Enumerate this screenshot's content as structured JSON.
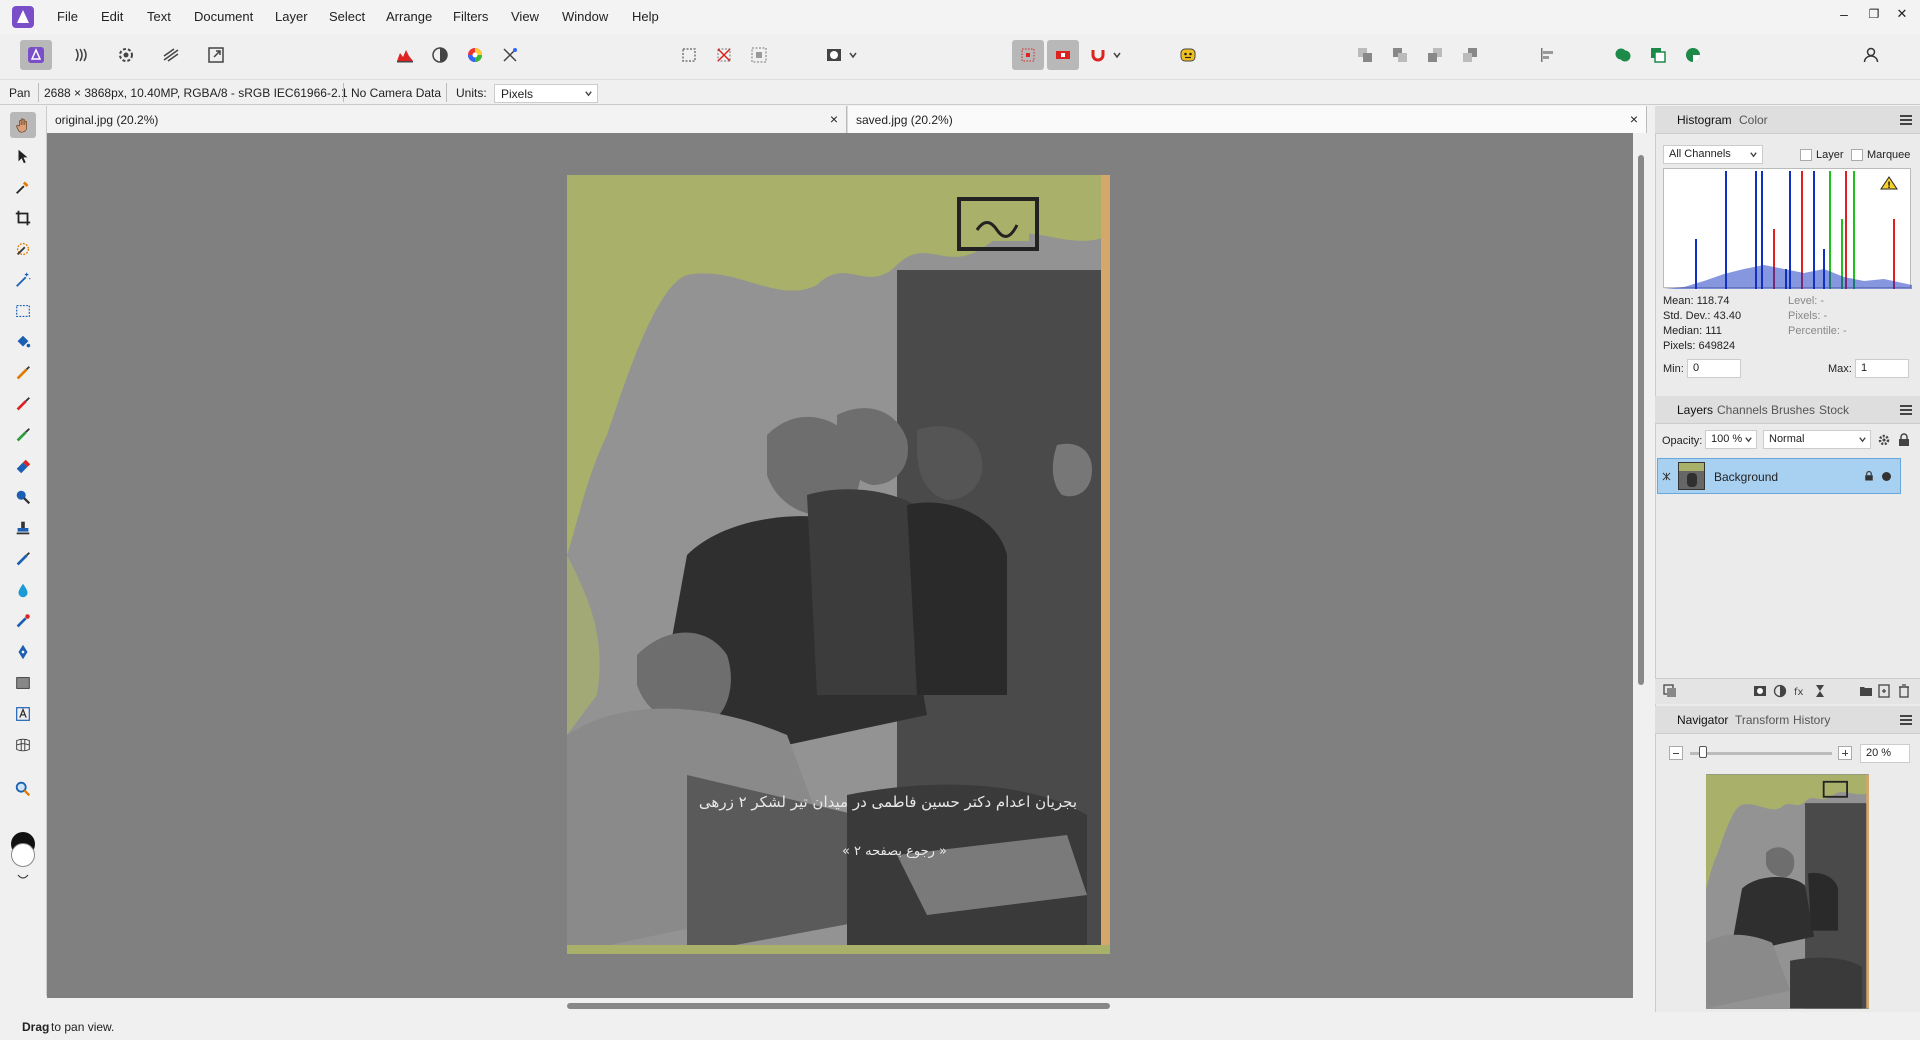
{
  "menu": [
    "File",
    "Edit",
    "Text",
    "Document",
    "Layer",
    "Select",
    "Arrange",
    "Filters",
    "View",
    "Window",
    "Help"
  ],
  "window_controls": [
    "–",
    "❐",
    "✕"
  ],
  "context": {
    "tool": "Pan",
    "doc_info": "2688 × 3868px, 10.40MP, RGBA/8 - sRGB IEC61966-2.1",
    "camera": "No Camera Data",
    "units_label": "Units:",
    "units_value": "Pixels"
  },
  "tabs": [
    {
      "label": "original.jpg (20.2%)",
      "close": "×"
    },
    {
      "label": "saved.jpg (20.2%)",
      "close": "×"
    }
  ],
  "photo_caption": "بجریان اعدام دکتر حسین فاطمی در میدان تیر لشکر ۲ زرهی",
  "photo_caption2": "« رجوع بصفحه ۲ »",
  "histogram": {
    "tabs": [
      "Histogram",
      "Color"
    ],
    "channel": "All Channels",
    "layer_label": "Layer",
    "marquee_label": "Marquee",
    "mean": "Mean: 118.74",
    "std": "Std. Dev.: 43.40",
    "median": "Median: 111",
    "pixels": "Pixels: 649824",
    "level": "Level: -",
    "pixels_sel": "Pixels: -",
    "percentile": "Percentile: -",
    "min_label": "Min:",
    "min_value": "0",
    "max_label": "Max:",
    "max_value": "1"
  },
  "layers": {
    "tabs": [
      "Layers",
      "Channels",
      "Brushes",
      "Stock"
    ],
    "opacity_label": "Opacity:",
    "opacity_value": "100 %",
    "blend_mode": "Normal",
    "layer_name": "Background"
  },
  "navigator": {
    "tabs": [
      "Navigator",
      "Transform",
      "History"
    ],
    "zoom": "20 %"
  },
  "status": {
    "bold": "Drag",
    "text": " to pan view."
  },
  "colors": {
    "accent": "#7a4ec8",
    "canvas": "#808080",
    "selection": "#a8d0f0"
  }
}
